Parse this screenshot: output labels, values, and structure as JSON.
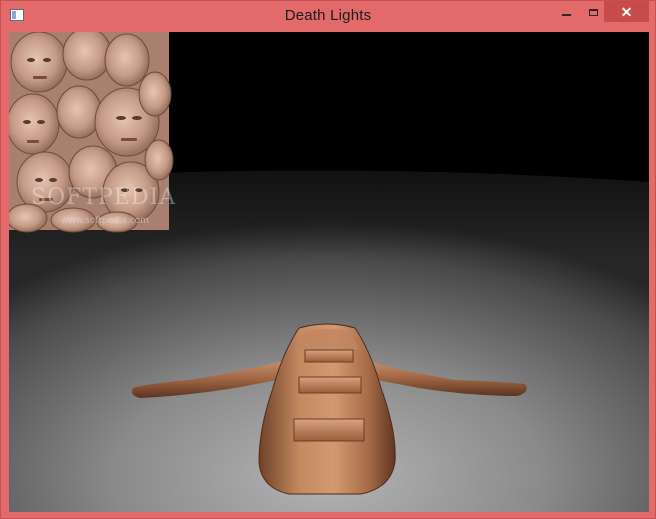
{
  "window": {
    "title": "Death Lights",
    "icon": "app-window-icon",
    "controls": {
      "minimize": "minimize-icon",
      "maximize": "maximize-icon",
      "close": "✕"
    }
  },
  "scene": {
    "watermark": "SOFTPEDIA",
    "watermark_url": "www.softpedia.com",
    "colors": {
      "frame": "#e36a6a",
      "close_button": "#c74b4b",
      "sky": "#000000",
      "floor": "#8c8c8c",
      "craft": "#b07552"
    }
  }
}
